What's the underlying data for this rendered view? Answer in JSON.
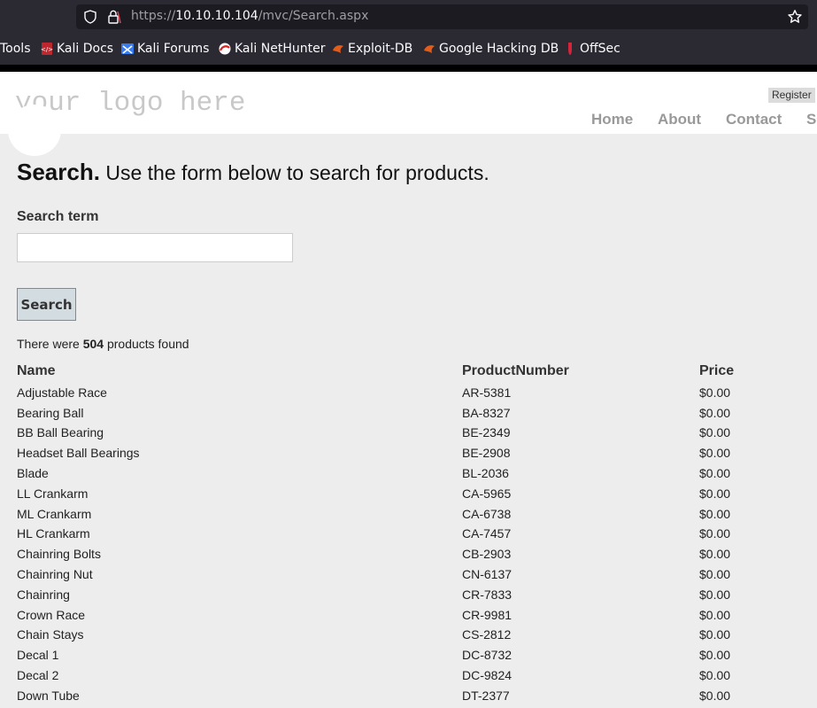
{
  "browser": {
    "url_prefix": "https://",
    "url_host": "10.10.10.104",
    "url_path": "/mvc/Search.aspx",
    "bookmarks": [
      {
        "label": "Tools",
        "icon": "none"
      },
      {
        "label": "Kali Docs",
        "icon": "kali-docs-icon"
      },
      {
        "label": "Kali Forums",
        "icon": "kali-forums-icon"
      },
      {
        "label": "Kali NetHunter",
        "icon": "kali-nethunter-icon"
      },
      {
        "label": "Exploit-DB",
        "icon": "exploit-db-icon"
      },
      {
        "label": "Google Hacking DB",
        "icon": "ghdb-icon"
      },
      {
        "label": "OffSec",
        "icon": "offsec-icon"
      }
    ]
  },
  "site": {
    "logo": "your logo here",
    "register": "Register",
    "nav": [
      "Home",
      "About",
      "Contact",
      "S"
    ]
  },
  "search": {
    "title": "Search.",
    "subtitle": "Use the form below to search for products.",
    "label": "Search term",
    "input_value": "",
    "button": "Search",
    "count_prefix": "There were",
    "count": "504",
    "count_suffix": "products found"
  },
  "results": {
    "columns": [
      "Name",
      "ProductNumber",
      "Price"
    ],
    "rows": [
      [
        "Adjustable Race",
        "AR-5381",
        "$0.00"
      ],
      [
        "Bearing Ball",
        "BA-8327",
        "$0.00"
      ],
      [
        "BB Ball Bearing",
        "BE-2349",
        "$0.00"
      ],
      [
        "Headset Ball Bearings",
        "BE-2908",
        "$0.00"
      ],
      [
        "Blade",
        "BL-2036",
        "$0.00"
      ],
      [
        "LL Crankarm",
        "CA-5965",
        "$0.00"
      ],
      [
        "ML Crankarm",
        "CA-6738",
        "$0.00"
      ],
      [
        "HL Crankarm",
        "CA-7457",
        "$0.00"
      ],
      [
        "Chainring Bolts",
        "CB-2903",
        "$0.00"
      ],
      [
        "Chainring Nut",
        "CN-6137",
        "$0.00"
      ],
      [
        "Chainring",
        "CR-7833",
        "$0.00"
      ],
      [
        "Crown Race",
        "CR-9981",
        "$0.00"
      ],
      [
        "Chain Stays",
        "CS-2812",
        "$0.00"
      ],
      [
        "Decal 1",
        "DC-8732",
        "$0.00"
      ],
      [
        "Decal 2",
        "DC-9824",
        "$0.00"
      ],
      [
        "Down Tube",
        "DT-2377",
        "$0.00"
      ]
    ]
  }
}
